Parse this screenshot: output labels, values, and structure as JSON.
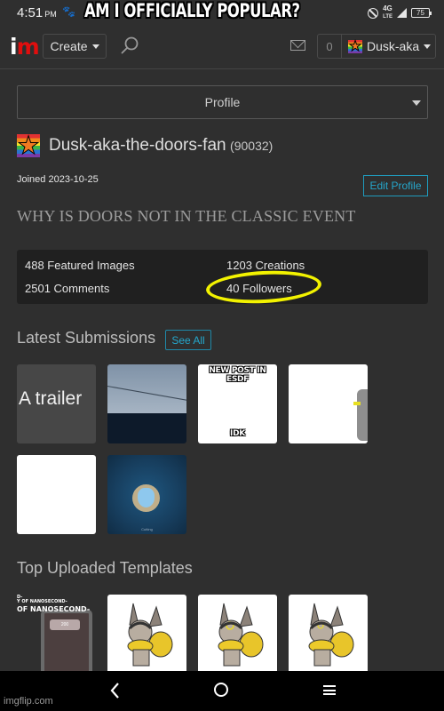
{
  "status_bar": {
    "time": "4:51",
    "ampm": "PM",
    "network": "4G",
    "network_sub": "LTE",
    "battery": "75"
  },
  "meme_caption": "AM I OFFICIALLY POPULAR?",
  "navbar": {
    "logo_i": "i",
    "logo_m": "m",
    "create_label": "Create",
    "notification_count": "0",
    "user_label": "Dusk-aka"
  },
  "profile_select": {
    "selected": "Profile"
  },
  "profile": {
    "username": "Dusk-aka-the-doors-fan",
    "user_points": "(90032)",
    "joined": "Joined 2023-10-25",
    "edit_profile_label": "Edit Profile",
    "bio": "WHY IS DOORS NOT IN THE CLASSIC EVENT"
  },
  "stats": {
    "featured_images": "488 Featured Images",
    "creations": "1203 Creations",
    "comments": "2501 Comments",
    "followers": "40 Followers",
    "highlight_color": "#f2f200"
  },
  "latest_submissions": {
    "title": "Latest Submissions",
    "see_all_label": "See All",
    "items": [
      {
        "label": "A trailer"
      },
      {
        "label": ""
      },
      {
        "top_text": "NEW POST IN ESDF",
        "bottom_text": "IDK"
      },
      {
        "label": ""
      },
      {
        "label": ""
      },
      {
        "caption": "Cutting"
      }
    ]
  },
  "top_templates": {
    "title": "Top Uploaded Templates",
    "items": [
      {
        "line1": "D-",
        "line2": "Y OF NANOSECOND-",
        "line3": "OF NANOSECOND-",
        "tag": "200"
      },
      {
        "label": ""
      },
      {
        "label": ""
      },
      {
        "label": ""
      }
    ]
  },
  "watermark": "imgflip.com",
  "colors": {
    "accent": "#25a7cc",
    "logo_red": "#e00e0e",
    "background": "#2f2f2f",
    "stats_bg": "#202020"
  }
}
